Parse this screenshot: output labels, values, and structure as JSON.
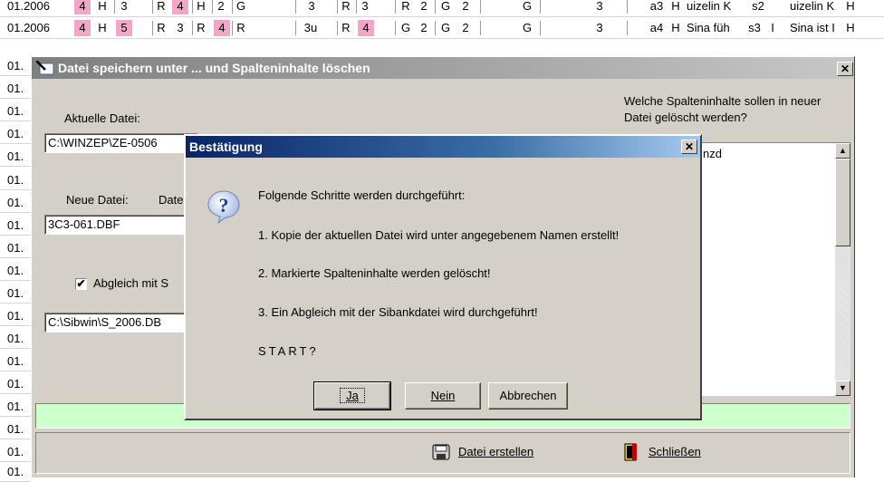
{
  "spreadsheet": {
    "row_label_prefix": "01.",
    "row1": {
      "label": "01.2006",
      "cells": [
        "4",
        "H",
        "3",
        "R",
        "4",
        "H",
        "2",
        "G",
        "3",
        "R",
        "3",
        "R",
        "2",
        "G",
        "2",
        "G",
        "3",
        "a3",
        "H",
        "uizelin K",
        "s2",
        "uizelin K",
        "H"
      ]
    },
    "row2": {
      "label": "01.2006",
      "cells": [
        "4",
        "H",
        "5",
        "R",
        "3",
        "R",
        "4",
        "R",
        "3u",
        "R",
        "4",
        "G",
        "2",
        "G",
        "2",
        "G",
        "3",
        "a4",
        "H",
        "Sina füh",
        "s3",
        "I",
        "Sina ist I",
        "H"
      ]
    }
  },
  "main_dialog": {
    "title": "Datei speichern unter ...  und Spalteninhalte löschen",
    "close_glyph": "✕",
    "current_file_label": "Aktuelle Datei:",
    "current_file_value": "C:\\WINZEP\\ZE-0506",
    "new_file_label": "Neue Datei:",
    "date_label_partial": "Date",
    "new_file_value": "3C3-061.DBF",
    "sync_checkbox_label": "Abgleich mit S",
    "sync_checked": true,
    "sibank_file_value": "C:\\Sibwin\\S_2006.DB",
    "columns_prompt": "Welche Spalteninhalte sollen in neuer Datei gelöscht werden?",
    "columns_list_first": "nzd",
    "create_file_button": "Datei erstellen",
    "close_button": "Schließen"
  },
  "confirm_dialog": {
    "title": "Bestätigung",
    "close_glyph": "✕",
    "intro": "Folgende Schritte werden durchgeführt:",
    "step1": "1. Kopie der aktuellen Datei wird unter angegebenem Namen erstellt!",
    "step2": "2. Markierte Spalteninhalte werden gelöscht!",
    "step3": "3. Ein Abgleich mit der Sibankdatei wird durchgeführt!",
    "start": "START?",
    "yes_button": "Ja",
    "no_button": "Nein",
    "cancel_button": "Abbrechen"
  },
  "colors": {
    "dialog_face": "#d4d0c8",
    "active_title": "#0a246a",
    "inactive_title": "#808080",
    "highlight_pink": "#f4a6c8",
    "status_green": "#ccffcc"
  }
}
